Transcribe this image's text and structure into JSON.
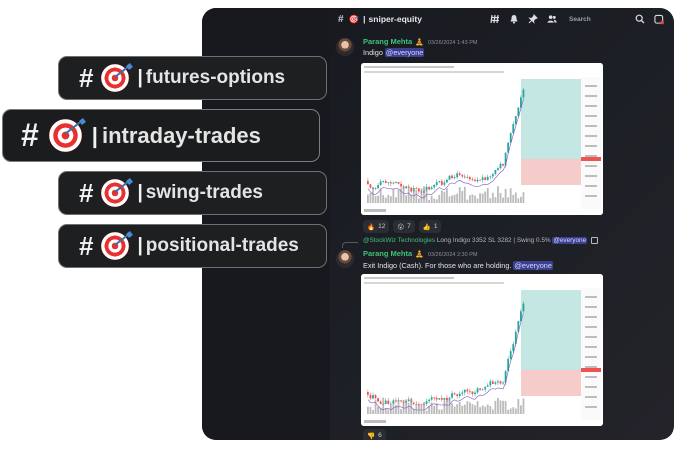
{
  "channel": {
    "hash": "#",
    "emoji": "🎯",
    "separator": "|",
    "name": "sniper-equity"
  },
  "toolbar": {
    "search_placeholder": "Search",
    "icons": [
      "threads-icon",
      "bell-icon",
      "pin-icon",
      "members-icon",
      "search-icon",
      "inbox-icon"
    ]
  },
  "messages": [
    {
      "author": "Parang Mehta",
      "badge": "🧘",
      "timestamp": "03/26/2024 1:43 PM",
      "text": "Indigo ",
      "mention": "@everyone",
      "reactions": [
        {
          "emoji": "🔥",
          "count": "12"
        },
        {
          "emoji": "😮",
          "count": "7"
        },
        {
          "emoji": "👍",
          "count": "1"
        }
      ]
    },
    {
      "reply_author": "@StockWiz Technologies",
      "reply_text": " Long Indigo 3352 SL 3282 | Swing 0.5% ",
      "reply_mention": "@everyone",
      "author": "Parang Mehta",
      "badge": "🧘",
      "timestamp": "03/26/2024 2:30 PM",
      "text": "Exit Indigo (Cash). For those who are holding. ",
      "mention": "@everyone",
      "reactions": [
        {
          "emoji": "👎",
          "count": "6"
        }
      ]
    }
  ],
  "channels_overlay": [
    {
      "hash": "#",
      "separator": "|",
      "name": "futures-options",
      "highlighted": false
    },
    {
      "hash": "#",
      "separator": "|",
      "name": "intraday-trades",
      "highlighted": true
    },
    {
      "hash": "#",
      "separator": "|",
      "name": "swing-trades",
      "highlighted": false
    },
    {
      "hash": "#",
      "separator": "|",
      "name": "positional-trades",
      "highlighted": false
    }
  ],
  "colors": {
    "author": "#3fc27a",
    "mention_bg": "#3b3f8f",
    "candle_up": "#26a69a",
    "candle_down": "#ef5350",
    "target_zone": "#b2dfdb",
    "stop_zone": "#f5c6c4"
  }
}
